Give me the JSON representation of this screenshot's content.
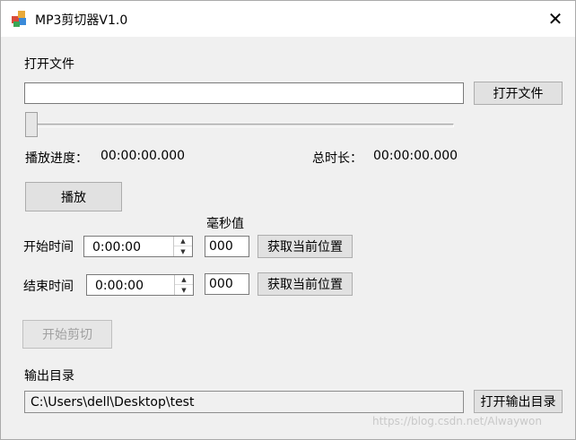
{
  "window": {
    "title": "MP3剪切器V1.0"
  },
  "open_file": {
    "label": "打开文件",
    "path_value": "",
    "button_label": "打开文件"
  },
  "progress": {
    "position_fraction": 0.0,
    "played_label": "播放进度：",
    "played_value": "00:00:00.000",
    "total_label": "总时长：",
    "total_value": "00:00:00.000"
  },
  "play_button": "播放",
  "ms_header": "毫秒值",
  "start": {
    "label": "开始时间",
    "time_value": "0:00:00",
    "ms_value": "000",
    "get_pos_button": "获取当前位置"
  },
  "end": {
    "label": "结束时间",
    "time_value": "0:00:00",
    "ms_value": "000",
    "get_pos_button": "获取当前位置"
  },
  "cut_button": "开始剪切",
  "output": {
    "label": "输出目录",
    "path_value": "C:\\Users\\dell\\Desktop\\test",
    "button_label": "打开输出目录"
  },
  "watermark": "https://blog.csdn.net/Alwaywon"
}
